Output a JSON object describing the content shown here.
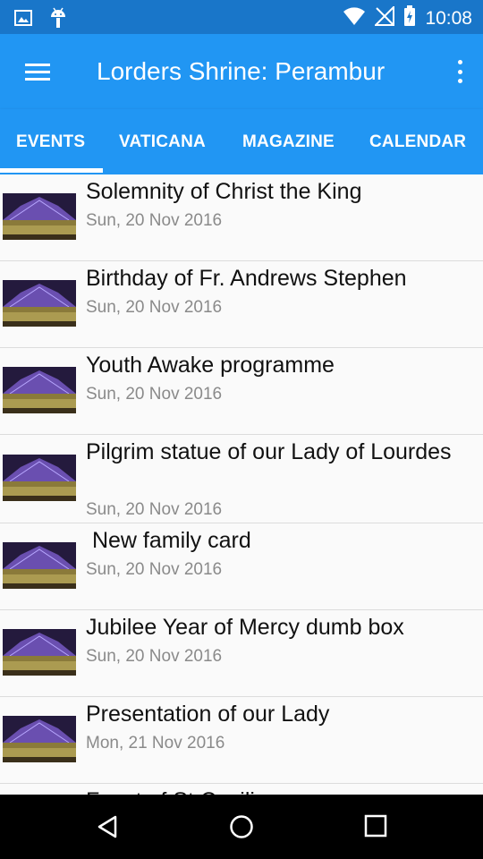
{
  "status_bar": {
    "time": "10:08",
    "icons": [
      "image-icon",
      "android-icon",
      "wifi-icon",
      "no-signal-icon",
      "battery-charging-icon"
    ]
  },
  "app_bar": {
    "title": "Lorders Shrine: Perambur",
    "menu_icon": "hamburger-menu-icon",
    "overflow_icon": "more-vert-icon"
  },
  "tabs": [
    {
      "label": "EVENTS",
      "selected": true
    },
    {
      "label": "VATICANA",
      "selected": false
    },
    {
      "label": "MAGAZINE",
      "selected": false
    },
    {
      "label": "CALENDAR",
      "selected": false
    }
  ],
  "events": [
    {
      "title": "Solemnity of Christ the King",
      "date": "Sun, 20 Nov 2016"
    },
    {
      "title": "Birthday of Fr. Andrews Stephen",
      "date": "Sun, 20 Nov 2016"
    },
    {
      "title": "Youth Awake programme",
      "date": "Sun, 20 Nov 2016"
    },
    {
      "title": "Pilgrim statue of our Lady of Lourdes",
      "date": "Sun, 20 Nov 2016"
    },
    {
      "title": " New family card",
      "date": "Sun, 20 Nov 2016"
    },
    {
      "title": "Jubilee Year of Mercy dumb box",
      "date": "Sun, 20 Nov 2016"
    },
    {
      "title": "Presentation of our Lady",
      "date": "Mon, 21 Nov 2016"
    },
    {
      "title": "Feast of St.Cecilia",
      "date": ""
    }
  ],
  "nav_bar": {
    "icons": [
      "back-icon",
      "home-icon",
      "recents-icon"
    ]
  },
  "colors": {
    "status_bar": "#1976c9",
    "primary": "#2196f3",
    "text_primary": "#111111",
    "text_secondary": "#8a8a8a"
  }
}
